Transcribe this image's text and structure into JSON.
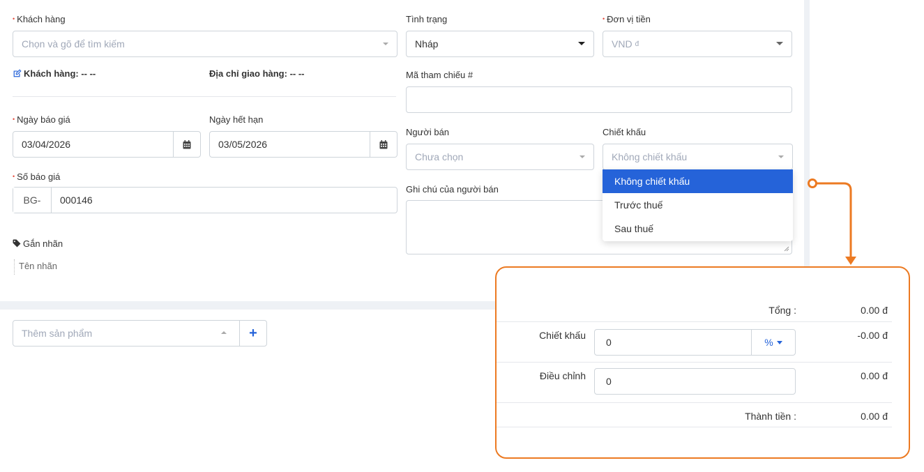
{
  "customer": {
    "label": "Khách hàng",
    "placeholder": "Chọn và gõ để tìm kiếm"
  },
  "status": {
    "label": "Tình trạng",
    "value": "Nháp"
  },
  "currency": {
    "label": "Đơn vị tiền",
    "value": "VND",
    "symbol": "đ"
  },
  "customer_info": {
    "customer_label": "Khách hàng: -- --",
    "shipping_label": "Địa chỉ giao hàng: -- --"
  },
  "reference": {
    "label": "Mã tham chiếu #",
    "value": ""
  },
  "quote_date": {
    "label": "Ngày báo giá",
    "value": "03/04/2026"
  },
  "expiry_date": {
    "label": "Ngày hết hạn",
    "value": "03/05/2026"
  },
  "seller": {
    "label": "Người bán",
    "placeholder": "Chưa chọn"
  },
  "discount": {
    "label": "Chiết khấu",
    "value": "Không chiết khấu",
    "options": [
      "Không chiết khấu",
      "Trước thuế",
      "Sau thuế"
    ],
    "selected_index": 0
  },
  "quote_number": {
    "label": "Số báo giá",
    "prefix": "BG-",
    "value": "000146"
  },
  "seller_note": {
    "label": "Ghi chú của người bán",
    "value": ""
  },
  "tags": {
    "label": "Gắn nhãn",
    "placeholder": "Tên nhãn"
  },
  "add_product": {
    "placeholder": "Thêm sản phẩm",
    "add_label": "+"
  },
  "totals": {
    "subtotal_label": "Tổng :",
    "subtotal_value": "0.00 đ",
    "discount_label": "Chiết khấu",
    "discount_input": "0",
    "discount_unit": "%",
    "discount_value": "-0.00 đ",
    "adjust_label": "Điều chỉnh",
    "adjust_input": "0",
    "adjust_value": "0.00 đ",
    "total_label": "Thành tiền :",
    "total_value": "0.00 đ"
  },
  "colors": {
    "accent": "#2563d9",
    "callout": "#ec7a22",
    "required": "#e74c3c"
  }
}
